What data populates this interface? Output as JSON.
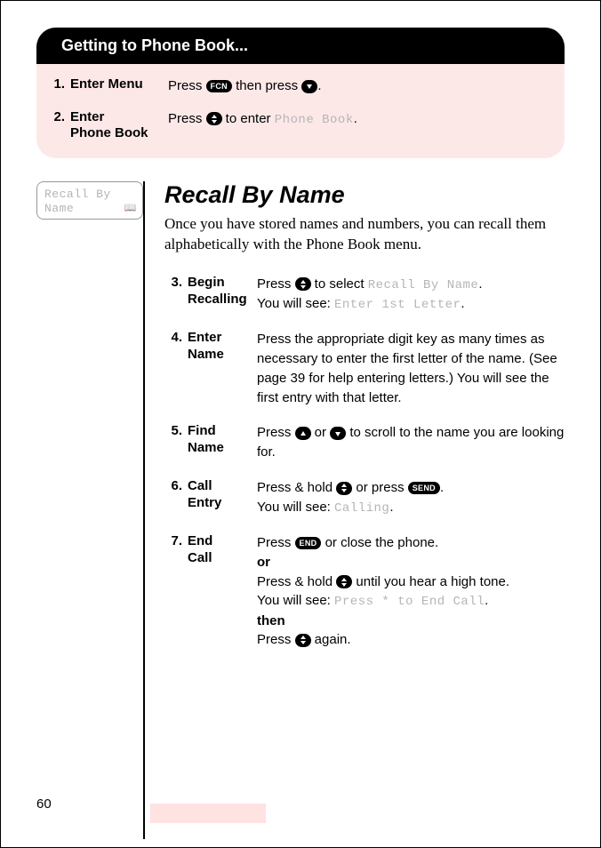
{
  "getting_to": {
    "header": "Getting to Phone Book...",
    "steps": [
      {
        "num": "1.",
        "label": "Enter Menu",
        "desc_pre": "Press ",
        "key1": "FCN",
        "mid": " then press ",
        "key2_glyph": true,
        "suffix": "."
      },
      {
        "num": "2.",
        "label_l1": "Enter",
        "label_l2": "Phone Book",
        "desc_pre": "Press ",
        "key_glyph": true,
        "mid": " to enter ",
        "mono": "Phone Book",
        "suffix": "."
      }
    ]
  },
  "display_box": {
    "line1": "Recall By",
    "line2": "Name"
  },
  "section": {
    "title": "Recall By Name",
    "intro": "Once you have stored names and numbers, you can recall them alphabetically with the Phone Book menu."
  },
  "steps": {
    "s3": {
      "num": "3.",
      "label_l1": "Begin",
      "label_l2": "Recalling",
      "l1_pre": "Press ",
      "l1_mid": " to select ",
      "l1_mono": "Recall By Name",
      "l1_suffix": ".",
      "l2_pre": "You will see: ",
      "l2_mono": "Enter 1st Letter",
      "l2_suffix": "."
    },
    "s4": {
      "num": "4.",
      "label_l1": "Enter",
      "label_l2": "Name",
      "text": "Press the appropriate digit key as many times as necessary to enter the first letter of the name. (See page 39 for help entering letters.) You will see the first entry with that letter."
    },
    "s5": {
      "num": "5.",
      "label_l1": "Find",
      "label_l2": "Name",
      "pre": "Press ",
      "mid": " or ",
      "post": " to scroll to the name you are looking for."
    },
    "s6": {
      "num": "6.",
      "label_l1": "Call",
      "label_l2": "Entry",
      "l1_pre": "Press & hold ",
      "l1_mid": " or press ",
      "l1_key": "SEND",
      "l1_suffix": ".",
      "l2_pre": "You will see: ",
      "l2_mono": "Calling",
      "l2_suffix": "."
    },
    "s7": {
      "num": "7.",
      "label_l1": "End",
      "label_l2": "Call",
      "l1_pre": "Press ",
      "l1_key": "END",
      "l1_suffix": " or close the phone.",
      "or": "or",
      "l2_pre": "Press & hold ",
      "l2_suffix": " until you hear a high tone.",
      "l3_pre": "You will see: ",
      "l3_mono": "Press * to End Call",
      "l3_suffix": ".",
      "then": "then",
      "l4_pre": "Press ",
      "l4_suffix": " again."
    }
  },
  "page_number": "60"
}
